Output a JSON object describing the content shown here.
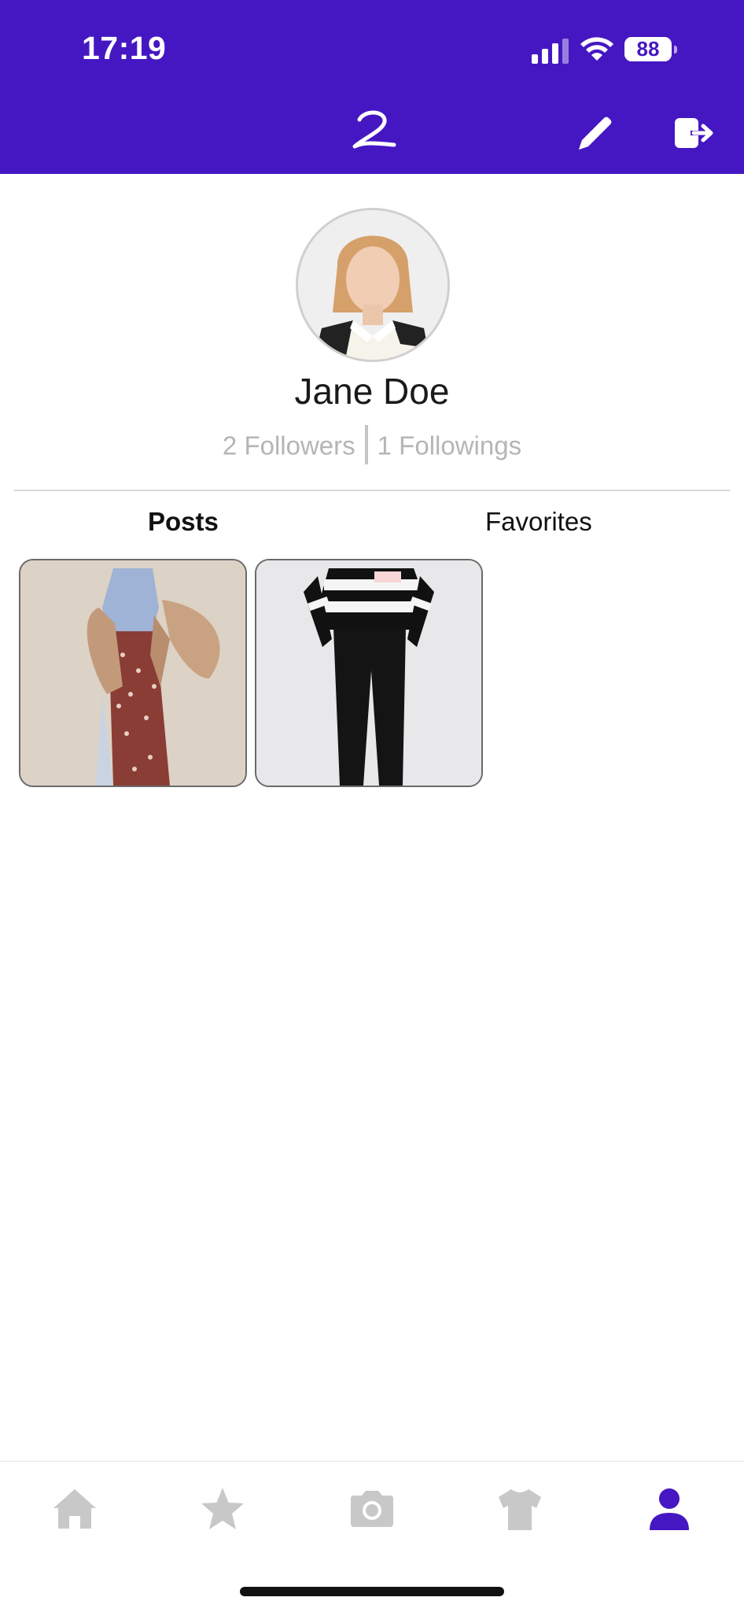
{
  "status_bar": {
    "time": "17:19",
    "battery": "88"
  },
  "profile": {
    "name": "Jane Doe",
    "followers": "2 Followers",
    "followings": "1 Followings"
  },
  "tabs": {
    "posts": "Posts",
    "favorites": "Favorites"
  },
  "bottom_nav": [
    {
      "icon": "home-icon",
      "active": false
    },
    {
      "icon": "star-icon",
      "active": false
    },
    {
      "icon": "camera-icon",
      "active": false
    },
    {
      "icon": "tshirt-icon",
      "active": false
    },
    {
      "icon": "user-icon",
      "active": true
    }
  ],
  "colors": {
    "brand": "#4517C2",
    "inactive_icon": "#c8c8c8"
  }
}
